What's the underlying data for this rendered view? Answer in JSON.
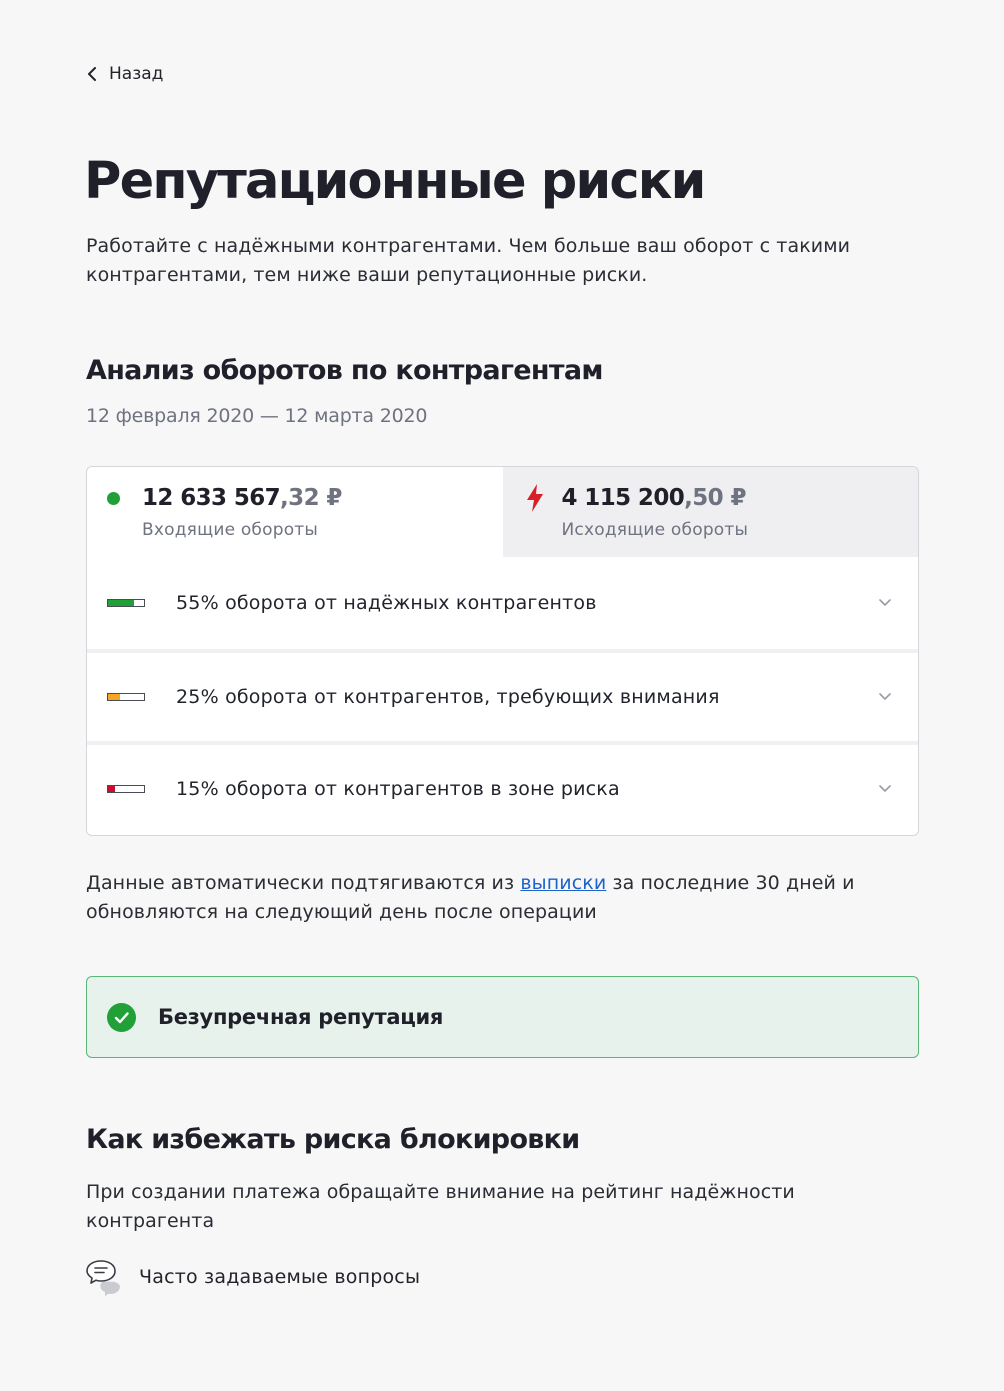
{
  "back_label": "Назад",
  "title": "Репутационные риски",
  "lead": "Работайте с надёжными контрагентами. Чем больше ваш оборот с такими контрагентами, тем ниже ваши репутационные риски.",
  "analysis": {
    "heading": "Анализ оборотов по контрагентам",
    "period": "12 февраля 2020 — 12 марта 2020",
    "incoming": {
      "whole": "12 633 567",
      "cents": ",32",
      "currency": " ₽",
      "label": "Входящие обороты",
      "icon": "green-dot-icon",
      "color": "#21a038"
    },
    "outgoing": {
      "whole": "4 115 200",
      "cents": ",50",
      "currency": " ₽",
      "label": "Исходящие обороты",
      "icon": "lightning-icon",
      "color": "#d61f26"
    },
    "rows": [
      {
        "text": "55% оборота от надёжных контрагентов",
        "share": 0.55,
        "color": "#21a038",
        "icon": "reliability-meter-icon"
      },
      {
        "text": "25% оборота от контрагентов, требующих внимания",
        "share": 0.25,
        "color": "#f5a623",
        "icon": "attention-meter-icon"
      },
      {
        "text": "15% оборота от контрагентов в зоне риска",
        "share": 0.15,
        "color": "#c8102e",
        "icon": "risk-meter-icon"
      }
    ]
  },
  "note": {
    "before": "Данные автоматически подтягиваются из ",
    "link": "выписки",
    "after": " за последние 30 дней и обновляются на следующий день после операции"
  },
  "status": {
    "label": "Безупречная репутация",
    "icon": "check-circle-icon",
    "color": "#21a038"
  },
  "howto": {
    "heading": "Как избежать риска блокировки",
    "text": "При создании платежа обращайте внимание на рейтинг надёжности контрагента",
    "faq_label": "Часто задаваемые вопросы",
    "faq_icon": "chat-bubbles-icon"
  }
}
